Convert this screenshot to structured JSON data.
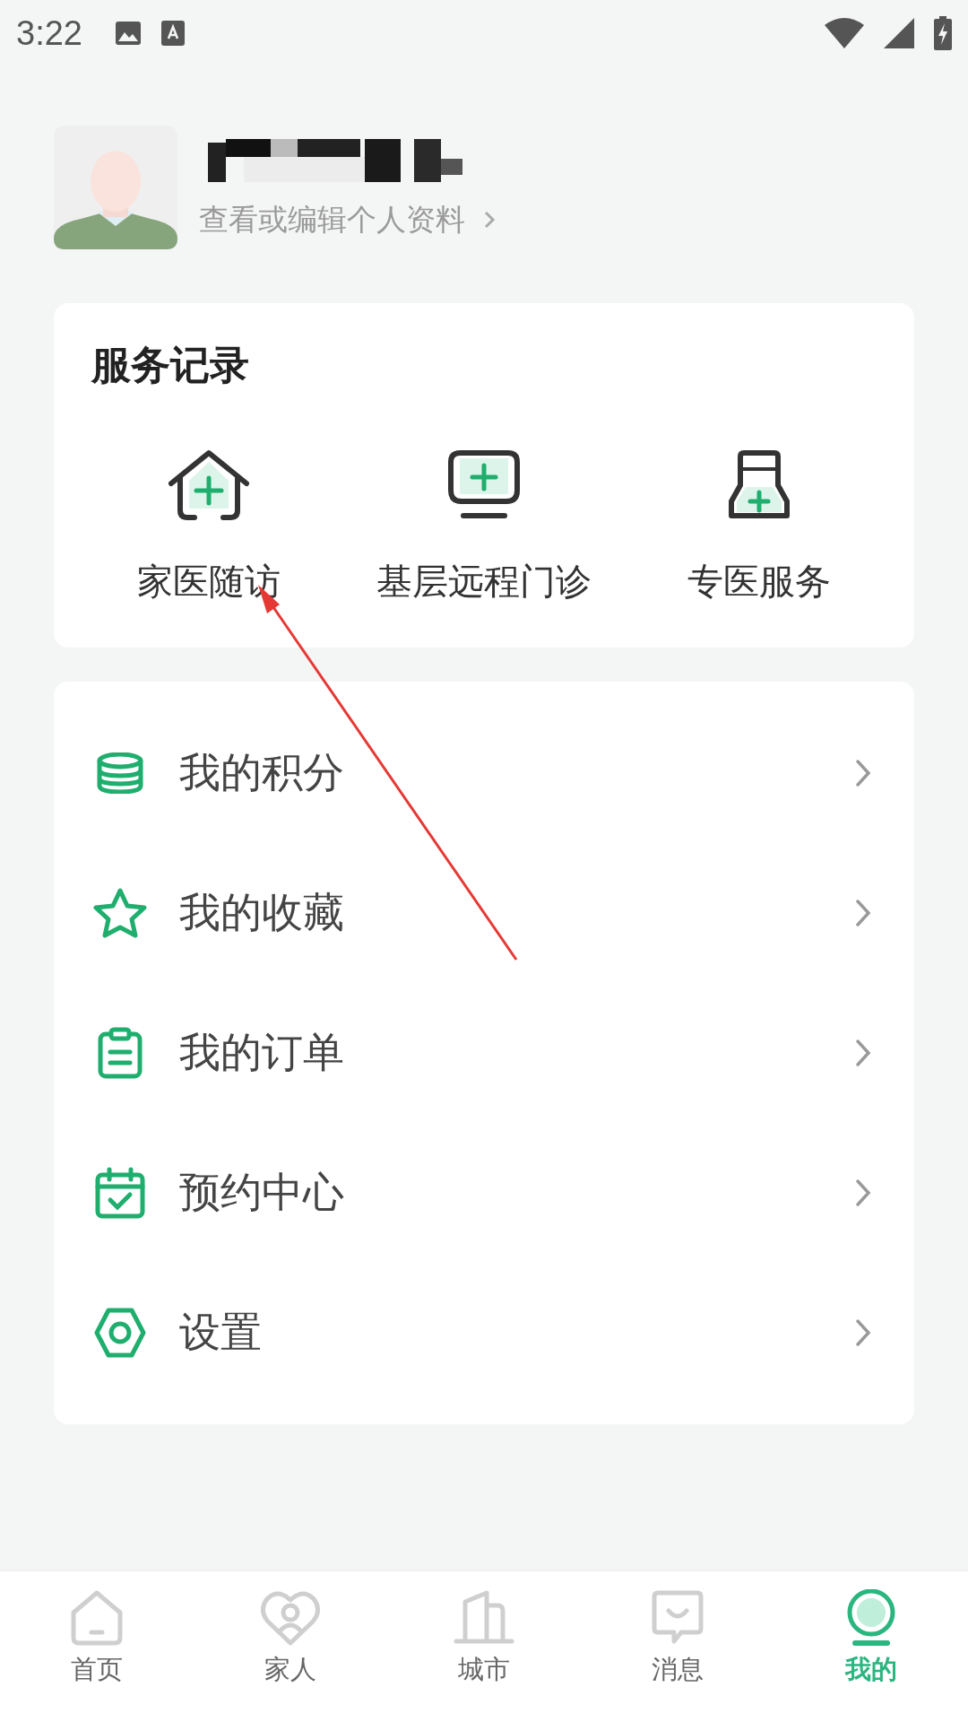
{
  "status_bar": {
    "time": "3:22"
  },
  "profile": {
    "name_redacted": true,
    "edit_link": "查看或编辑个人资料"
  },
  "service_records": {
    "title": "服务记录",
    "items": [
      {
        "label": "家医随访"
      },
      {
        "label": "基层远程门诊"
      },
      {
        "label": "专医服务"
      }
    ]
  },
  "menu": [
    {
      "label": "我的积分"
    },
    {
      "label": "我的收藏"
    },
    {
      "label": "我的订单"
    },
    {
      "label": "预约中心"
    },
    {
      "label": "设置"
    }
  ],
  "bottom_nav": [
    {
      "label": "首页",
      "selected": false
    },
    {
      "label": "家人",
      "selected": false
    },
    {
      "label": "城市",
      "selected": false
    },
    {
      "label": "消息",
      "selected": false
    },
    {
      "label": "我的",
      "selected": true
    }
  ],
  "annotation": {
    "kind": "arrow"
  }
}
